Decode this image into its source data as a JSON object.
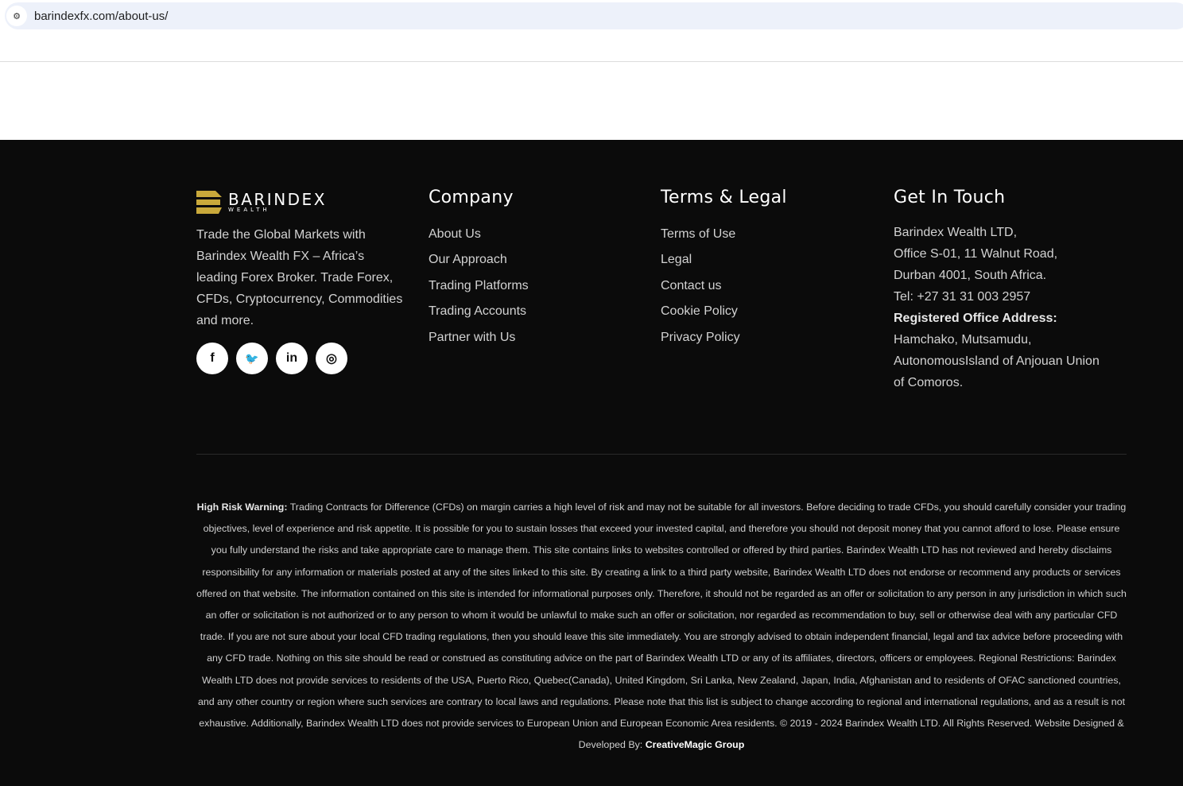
{
  "browser": {
    "url": "barindexfx.com/about-us/"
  },
  "footer": {
    "logo": {
      "name": "BARINDEX",
      "sub": "WEALTH",
      "color": "#c9a93b"
    },
    "description": "Trade the Global Markets with Barindex Wealth FX – Africa’s leading Forex Broker. Trade Forex, CFDs, Cryptocurrency, Commodities and more.",
    "social": [
      {
        "icon": "facebook-icon",
        "glyph": "f"
      },
      {
        "icon": "twitter-icon",
        "glyph": "🐦"
      },
      {
        "icon": "linkedin-icon",
        "glyph": "in"
      },
      {
        "icon": "instagram-icon",
        "glyph": "◎"
      }
    ],
    "company": {
      "title": "Company",
      "items": [
        "About Us",
        "Our Approach",
        "Trading Platforms",
        "Trading Accounts",
        "Partner with Us"
      ]
    },
    "legal": {
      "title": "Terms & Legal",
      "items": [
        "Terms of Use",
        "Legal",
        "Contact us",
        "Cookie Policy",
        "Privacy Policy"
      ]
    },
    "contact": {
      "title": "Get In Touch",
      "lines": [
        "Barindex Wealth LTD,",
        "Office S-01, 11 Walnut Road,",
        "Durban 4001, South Africa.",
        "Tel: +27 31 31 003 2957"
      ],
      "registered_label": "Registered Office Address:",
      "registered_lines": [
        "Hamchako, Mutsamudu,",
        "AutonomousIsland of Anjouan Union",
        "of Comoros."
      ]
    },
    "risk": {
      "label": "High Risk Warning:",
      "text": " Trading Contracts for Difference (CFDs) on margin carries a high level of risk and may not be suitable for all investors. Before deciding to trade CFDs, you should carefully consider your trading objectives, level of experience and risk appetite. It is possible for you to sustain losses that exceed your invested capital, and therefore you should not deposit money that you cannot afford to lose. Please ensure you fully understand the risks and take appropriate care to manage them. This site contains links to websites controlled or offered by third parties. Barindex Wealth LTD has not reviewed and hereby disclaims responsibility for any information or materials posted at any of the sites linked to this site. By creating a link to a third party website, Barindex Wealth LTD does not endorse or recommend any products or services offered on that website. The information contained on this site is intended for informational purposes only. Therefore, it should not be regarded as an offer or solicitation to any person in any jurisdiction in which such an offer or solicitation is not authorized or to any person to whom it would be unlawful to make such an offer or solicitation, nor regarded as recommendation to buy, sell or otherwise deal with any particular CFD trade. If you are not sure about your local CFD trading regulations, then you should leave this site immediately. You are strongly advised to obtain independent financial, legal and tax advice before proceeding with any CFD trade. Nothing on this site should be read or construed as constituting advice on the part of Barindex Wealth LTD or any of its affiliates, directors, officers or employees. Regional Restrictions: Barindex Wealth LTD does not provide services to residents of the USA, Puerto Rico, Quebec(Canada), United Kingdom, Sri Lanka, New Zealand, Japan, India, Afghanistan and to residents of OFAC sanctioned countries, and any other country or region where such services are contrary to local laws and regulations. Please note that this list is subject to change according to regional and international regulations, and as a result is not exhaustive. Additionally, Barindex Wealth LTD does not provide services to European Union and European Economic Area residents. © 2019 - 2024 Barindex Wealth LTD. All Rights Reserved. Website Designed & Developed By: ",
      "credit": "CreativeMagic Group"
    }
  }
}
